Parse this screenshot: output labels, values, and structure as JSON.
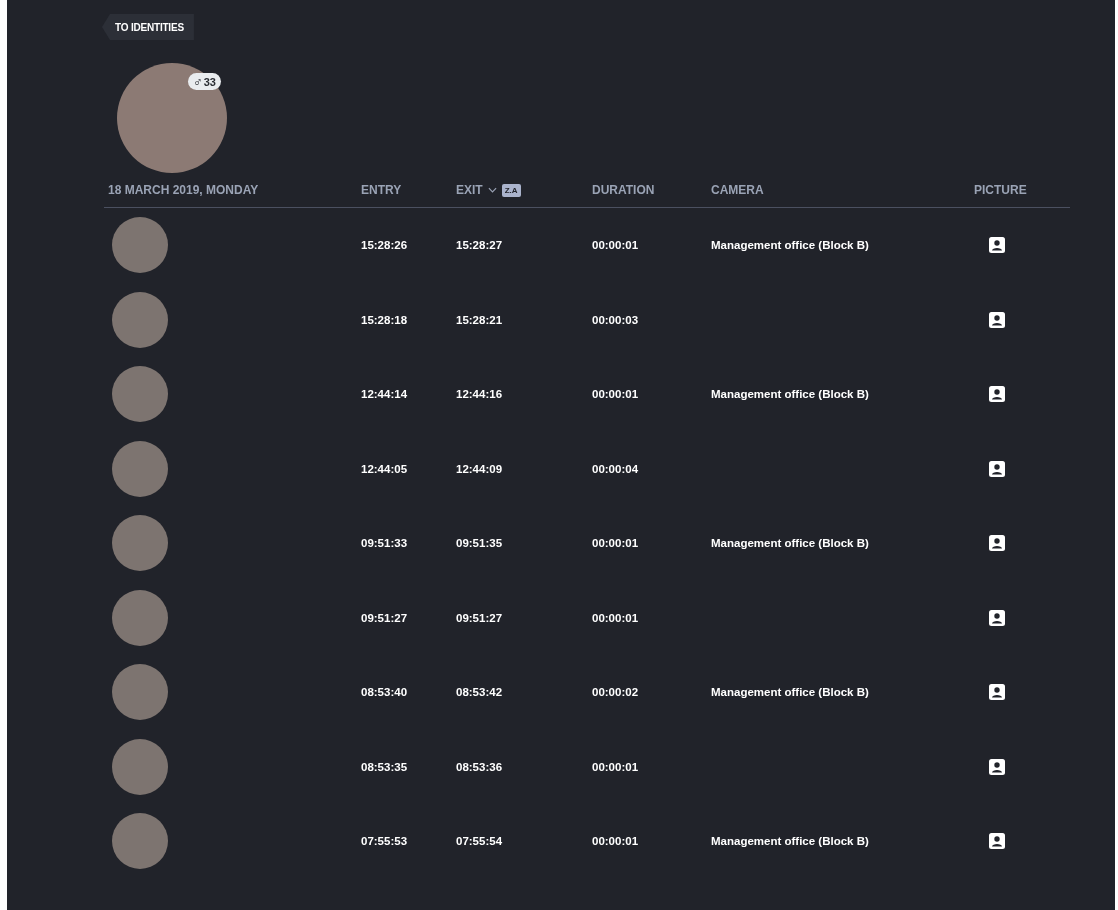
{
  "back_button": {
    "label": "TO IDENTITIES"
  },
  "profile": {
    "gender_symbol": "♂",
    "age": "33"
  },
  "table": {
    "date_heading": "18 MARCH 2019, MONDAY",
    "columns": [
      {
        "label": "ENTRY",
        "sorted": false
      },
      {
        "label": "EXIT",
        "sorted": true,
        "sort_badge": "Z.A"
      },
      {
        "label": "DURATION",
        "sorted": false
      },
      {
        "label": "CAMERA",
        "sorted": false
      },
      {
        "label": "PICTURE",
        "sorted": false
      }
    ],
    "rows": [
      {
        "entry": "15:28:26",
        "exit": "15:28:27",
        "duration": "00:00:01",
        "camera": "Management office (Block B)"
      },
      {
        "entry": "15:28:18",
        "exit": "15:28:21",
        "duration": "00:00:03"
      },
      {
        "entry": "12:44:14",
        "exit": "12:44:16",
        "duration": "00:00:01",
        "camera": "Management office (Block B)"
      },
      {
        "entry": "12:44:05",
        "exit": "12:44:09",
        "duration": "00:00:04"
      },
      {
        "entry": "09:51:33",
        "exit": "09:51:35",
        "duration": "00:00:01",
        "camera": "Management office (Block B)"
      },
      {
        "entry": "09:51:27",
        "exit": "09:51:27",
        "duration": "00:00:01"
      },
      {
        "entry": "08:53:40",
        "exit": "08:53:42",
        "duration": "00:00:02",
        "camera": "Management office (Block B)"
      },
      {
        "entry": "08:53:35",
        "exit": "08:53:36",
        "duration": "00:00:01"
      },
      {
        "entry": "07:55:53",
        "exit": "07:55:54",
        "duration": "00:00:01",
        "camera": "Management office (Block B)"
      }
    ]
  }
}
